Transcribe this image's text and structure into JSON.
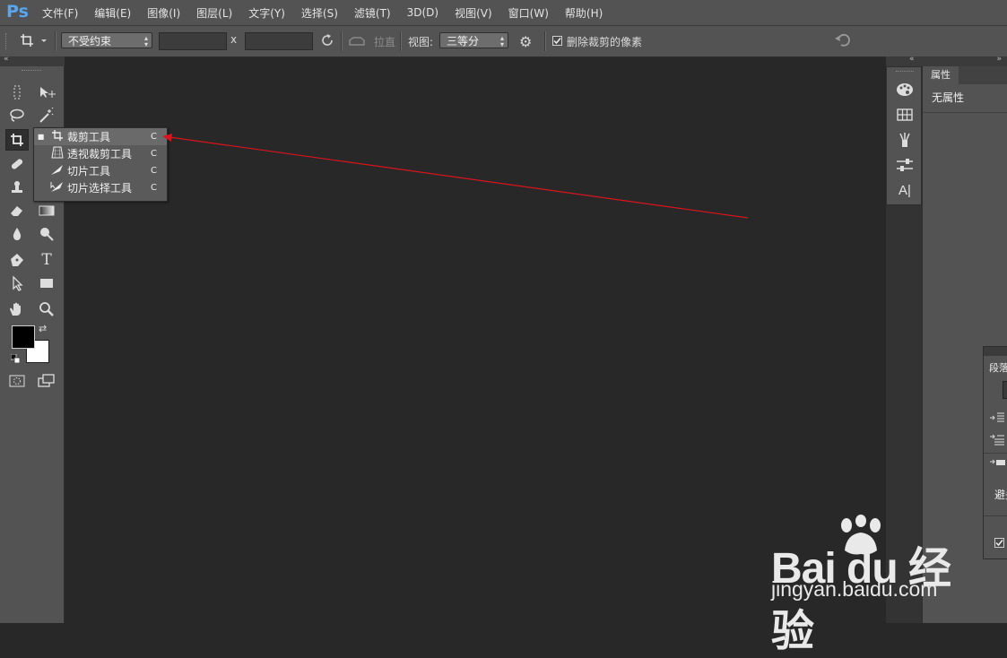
{
  "app": {
    "logo": "Ps"
  },
  "menubar": {
    "items": [
      "文件(F)",
      "编辑(E)",
      "图像(I)",
      "图层(L)",
      "文字(Y)",
      "选择(S)",
      "滤镜(T)",
      "3D(D)",
      "视图(V)",
      "窗口(W)",
      "帮助(H)"
    ]
  },
  "options": {
    "constraint": "不受约束",
    "width_value": "",
    "x_label": "x",
    "height_value": "",
    "straighten_label": "拉直",
    "view_label": "视图:",
    "view_value": "三等分",
    "delete_cropped_label": "删除裁剪的像素",
    "delete_cropped_checked": true
  },
  "toolbar": {
    "tools": [
      {
        "name": "marquee-tool-icon",
        "glyph": "⬚"
      },
      {
        "name": "move-tool-icon",
        "glyph": "▸✥"
      },
      {
        "name": "lasso-tool-icon",
        "glyph": "ℒ"
      },
      {
        "name": "magic-wand-tool-icon",
        "glyph": "✲"
      },
      {
        "name": "crop-tool-icon",
        "glyph": "⌗"
      },
      {
        "name": "eyedropper-tool-icon",
        "glyph": "✎"
      },
      {
        "name": "healing-brush-tool-icon",
        "glyph": "✚"
      },
      {
        "name": "brush-tool-icon",
        "glyph": "✐"
      },
      {
        "name": "stamp-tool-icon",
        "glyph": "♙"
      },
      {
        "name": "history-brush-tool-icon",
        "glyph": "↺"
      },
      {
        "name": "eraser-tool-icon",
        "glyph": "▱"
      },
      {
        "name": "gradient-tool-icon",
        "glyph": "▬"
      },
      {
        "name": "blur-tool-icon",
        "glyph": "💧"
      },
      {
        "name": "dodge-tool-icon",
        "glyph": "●"
      },
      {
        "name": "pen-tool-icon",
        "glyph": "✒"
      },
      {
        "name": "type-tool-icon",
        "glyph": "T"
      },
      {
        "name": "path-selection-tool-icon",
        "glyph": "➤"
      },
      {
        "name": "rectangle-tool-icon",
        "glyph": "▭"
      },
      {
        "name": "hand-tool-icon",
        "glyph": "✋"
      },
      {
        "name": "zoom-tool-icon",
        "glyph": "🔍"
      }
    ],
    "foreground_color": "#000000",
    "background_color": "#ffffff"
  },
  "flyout": {
    "items": [
      {
        "label": "裁剪工具",
        "shortcut": "C",
        "icon": "crop-icon",
        "selected": true
      },
      {
        "label": "透视裁剪工具",
        "shortcut": "C",
        "icon": "perspective-crop-icon",
        "selected": false
      },
      {
        "label": "切片工具",
        "shortcut": "C",
        "icon": "slice-icon",
        "selected": false
      },
      {
        "label": "切片选择工具",
        "shortcut": "C",
        "icon": "slice-select-icon",
        "selected": false
      }
    ]
  },
  "properties": {
    "tab_label": "属性",
    "content": "无属性"
  },
  "paragraph_panel": {
    "tab_label": "段落",
    "hyphenate_label": "避头"
  },
  "watermark": {
    "brand": "Bai du 经验",
    "url": "jingyan.baidu.com"
  },
  "colors": {
    "annotation_arrow": "#d9141e",
    "ps_blue": "#59a5f0"
  }
}
